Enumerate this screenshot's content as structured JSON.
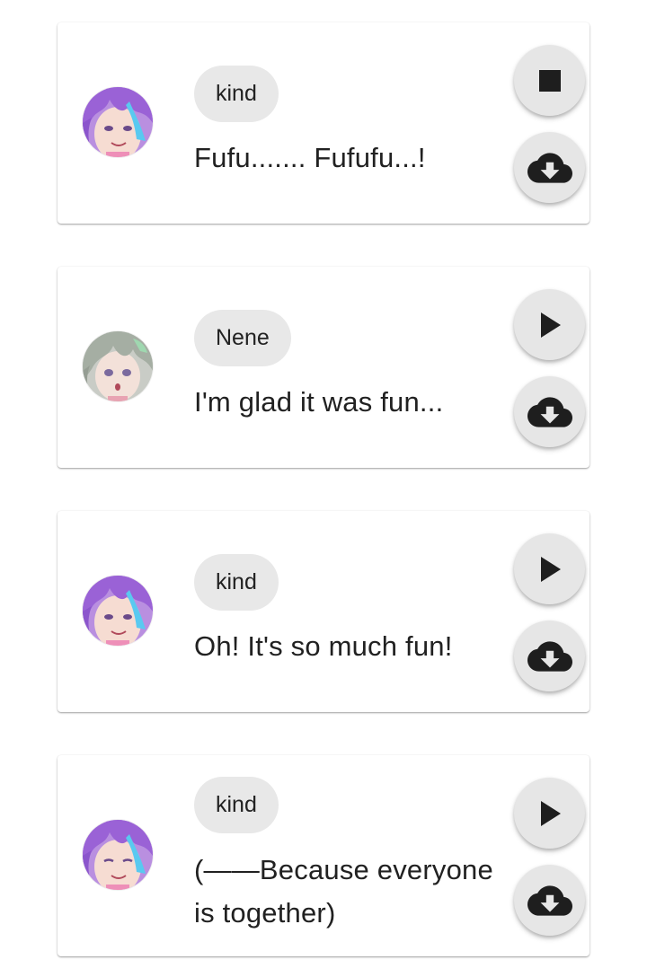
{
  "colors": {
    "card_bg": "#ffffff",
    "chip_bg": "#e8e8e8",
    "fab_bg": "#e6e6e6",
    "icon": "#1e1e1e",
    "text": "#212121"
  },
  "lines": [
    {
      "speaker": "kind",
      "avatar_icon": "purple-hair-character-avatar",
      "text": "Fufu....... Fufufu...!",
      "playback_state": "playing",
      "play_icon": "stop-icon",
      "download_icon": "cloud-download-icon"
    },
    {
      "speaker": "Nene",
      "avatar_icon": "gray-hair-character-avatar",
      "text": "I'm glad it was fun...",
      "playback_state": "stopped",
      "play_icon": "play-icon",
      "download_icon": "cloud-download-icon"
    },
    {
      "speaker": "kind",
      "avatar_icon": "purple-hair-character-avatar",
      "text": "Oh! It's so much fun!",
      "playback_state": "stopped",
      "play_icon": "play-icon",
      "download_icon": "cloud-download-icon"
    },
    {
      "speaker": "kind",
      "avatar_icon": "purple-hair-character-avatar",
      "text": "(——Because everyone is together)",
      "playback_state": "stopped",
      "play_icon": "play-icon",
      "download_icon": "cloud-download-icon"
    }
  ]
}
